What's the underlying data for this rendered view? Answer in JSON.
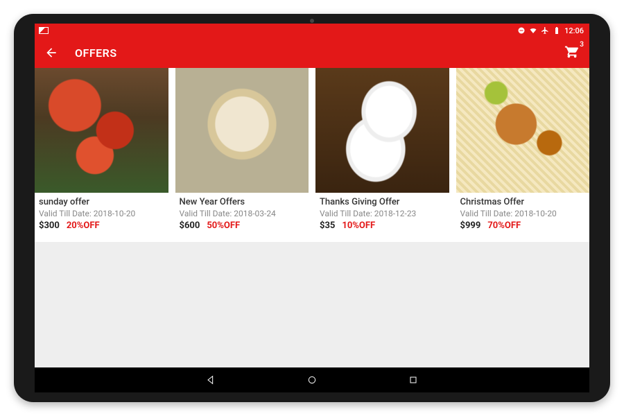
{
  "status": {
    "time": "12:06"
  },
  "header": {
    "title": "OFFERS",
    "cart_count": "3"
  },
  "valid_prefix": "Valid Till Date: ",
  "offers": [
    {
      "title": "sunday offer",
      "valid": "2018-10-20",
      "price": "$300",
      "discount": "20%OFF"
    },
    {
      "title": "New Year Offers",
      "valid": "2018-03-24",
      "price": "$600",
      "discount": "50%OFF"
    },
    {
      "title": "Thanks Giving Offer",
      "valid": "2018-12-23",
      "price": "$35",
      "discount": "10%OFF"
    },
    {
      "title": "Christmas  Offer",
      "valid": "2018-10-20",
      "price": "$999",
      "discount": "70%OFF"
    }
  ]
}
